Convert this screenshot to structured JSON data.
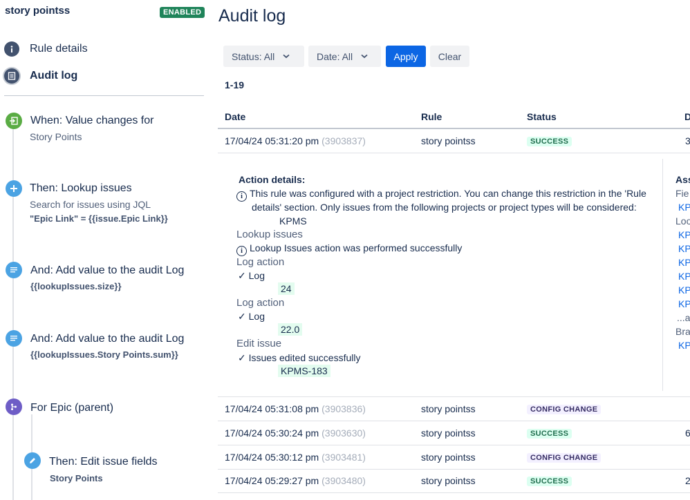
{
  "sidebar": {
    "rule_name": "story pointss",
    "status_badge": "ENABLED",
    "nav": {
      "rule_details": "Rule details",
      "audit_log": "Audit log"
    },
    "steps": [
      {
        "title": "When: Value changes for",
        "sub": "Story Points",
        "icon": "trigger-icon"
      },
      {
        "title": "Then: Lookup issues",
        "sub": "Search for issues using JQL",
        "code": "\"Epic Link\" = {{issue.Epic Link}}",
        "icon": "plus-icon"
      },
      {
        "title": "And: Add value to the audit Log",
        "code": "{{lookupIssues.size}}",
        "icon": "log-icon"
      },
      {
        "title": "And: Add value to the audit Log",
        "code": "{{lookupIssues.Story Points.sum}}",
        "icon": "log-icon"
      },
      {
        "title": "For Epic (parent)",
        "icon": "branch-icon"
      },
      {
        "title": "Then: Edit issue fields",
        "code": "Story Points",
        "icon": "pencil-icon"
      }
    ]
  },
  "main": {
    "title": "Audit log",
    "filters": {
      "status": "Status: All",
      "date": "Date: All",
      "apply": "Apply",
      "clear": "Clear"
    },
    "range": "1-19",
    "columns": {
      "date": "Date",
      "rule": "Rule",
      "status": "Status",
      "d": "D"
    },
    "rows": [
      {
        "date": "17/04/24 05:31:20 pm",
        "id": "(3903837)",
        "rule": "story pointss",
        "status": "SUCCESS",
        "extra": "3"
      },
      {
        "date": "17/04/24 05:31:08 pm",
        "id": "(3903836)",
        "rule": "story pointss",
        "status": "CONFIG CHANGE",
        "extra": ""
      },
      {
        "date": "17/04/24 05:30:24 pm",
        "id": "(3903630)",
        "rule": "story pointss",
        "status": "SUCCESS",
        "extra": "6"
      },
      {
        "date": "17/04/24 05:30:12 pm",
        "id": "(3903481)",
        "rule": "story pointss",
        "status": "CONFIG CHANGE",
        "extra": ""
      },
      {
        "date": "17/04/24 05:29:27 pm",
        "id": "(3903480)",
        "rule": "story pointss",
        "status": "SUCCESS",
        "extra": "2"
      }
    ],
    "details": {
      "title": "Action details:",
      "restriction_line1": "This rule was configured with a project restriction. You can change this restriction in the 'Rule",
      "restriction_line2": "details' section. Only issues from the following projects or project types will be considered:",
      "restriction_project": "KPMS",
      "lookup_head": "Lookup issues",
      "lookup_msg": "Lookup Issues action was performed successfully",
      "log_head_1": "Log action",
      "log_label_1": "Log",
      "log_value_1": "24",
      "log_head_2": "Log action",
      "log_label_2": "Log",
      "log_value_2": "22.0",
      "edit_head": "Edit issue",
      "edit_msg": "Issues edited successfully",
      "edit_value": "KPMS-183"
    },
    "right_col": {
      "head": "Ass",
      "fields_label": "Fie",
      "k1": "KP",
      "lookup_label": "Loo",
      "k2": "KP",
      "k3": "KP",
      "k4": "KP",
      "k5": "KP",
      "k6": "KP",
      "k7": "KP",
      "more": "...a",
      "branch_label": "Bra",
      "k8": "KP"
    }
  }
}
